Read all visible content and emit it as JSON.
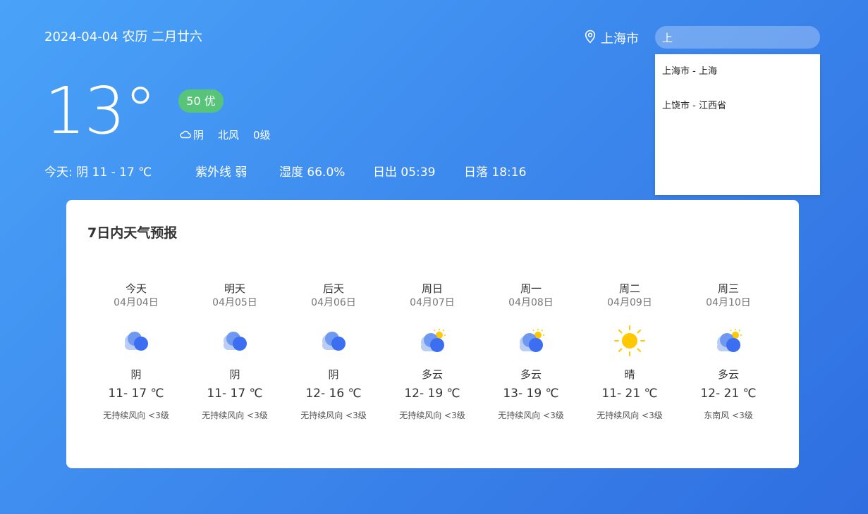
{
  "header": {
    "date": "2024-04-04 农历  二月廿六",
    "city": "上海市",
    "search_value": "上"
  },
  "search_results": [
    {
      "label": "上海市 - 上海"
    },
    {
      "label": "上饶市 - 江西省"
    }
  ],
  "current": {
    "temperature": "13°",
    "aqi": "50 优",
    "condition": "阴",
    "wind_direction": "北风",
    "wind_level": "0级"
  },
  "today": {
    "summary": "今天:  阴 11 - 17 ℃",
    "uv": "紫外线 弱",
    "humidity": "湿度 66.0%",
    "sunrise": "日出 05:39",
    "sunset": "日落 18:16"
  },
  "forecast": {
    "title": "7日内天气预报",
    "days": [
      {
        "name": "今天",
        "date": "04月04日",
        "icon": "overcast-cloud-icon",
        "cond": "阴",
        "range": "11- 17 ℃",
        "wind": "无持续风向 <3级"
      },
      {
        "name": "明天",
        "date": "04月05日",
        "icon": "overcast-cloud-icon",
        "cond": "阴",
        "range": "11- 17 ℃",
        "wind": "无持续风向 <3级"
      },
      {
        "name": "后天",
        "date": "04月06日",
        "icon": "overcast-cloud-icon",
        "cond": "阴",
        "range": "12- 16 ℃",
        "wind": "无持续风向 <3级"
      },
      {
        "name": "周日",
        "date": "04月07日",
        "icon": "partly-cloudy-icon",
        "cond": "多云",
        "range": "12- 19 ℃",
        "wind": "无持续风向 <3级"
      },
      {
        "name": "周一",
        "date": "04月08日",
        "icon": "partly-cloudy-icon",
        "cond": "多云",
        "range": "13- 19 ℃",
        "wind": "无持续风向 <3级"
      },
      {
        "name": "周二",
        "date": "04月09日",
        "icon": "sun-icon",
        "cond": "晴",
        "range": "11- 21 ℃",
        "wind": "无持续风向 <3级"
      },
      {
        "name": "周三",
        "date": "04月10日",
        "icon": "partly-cloudy-icon",
        "cond": "多云",
        "range": "12- 21 ℃",
        "wind": "东南风 <3级"
      }
    ]
  },
  "colors": {
    "aqi_good": "#58c47a",
    "cloud_dark": "#3b6ef0",
    "cloud_light": "#b9cdf5",
    "sun": "#ffc800"
  }
}
